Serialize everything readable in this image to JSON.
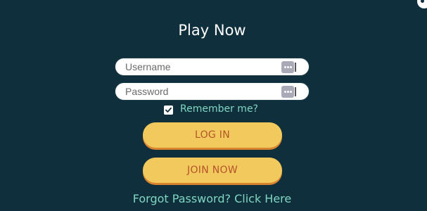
{
  "login_form": {
    "title": "Play Now",
    "username": {
      "placeholder": "Username",
      "value": ""
    },
    "password": {
      "placeholder": "Password",
      "value": ""
    },
    "remember_me": {
      "label": "Remember me?",
      "checked": true
    },
    "login_button_label": "LOG IN",
    "join_button_label": "JOIN NOW",
    "forgot_password_link": "Forgot Password? Click Here"
  },
  "icons": {
    "password_manager": "keychain-icon",
    "checkmark": "checkmark-icon",
    "close": "close-icon"
  },
  "colors": {
    "background": "#0f2f3d",
    "button": "#f2c95c",
    "button_shadow": "#d9832f",
    "button_text": "#b5542a",
    "accent_text": "#7fd6c1",
    "title": "#ffffff"
  }
}
